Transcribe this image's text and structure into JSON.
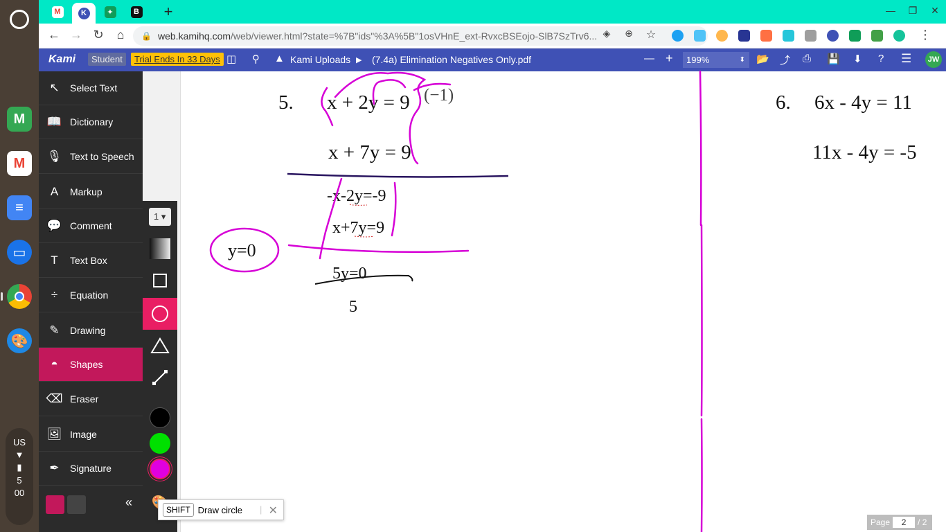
{
  "shelf": {
    "tray": {
      "locale": "US",
      "time_hour": "5",
      "time_min": "00"
    },
    "app_colors": {
      "meet": "#34a853",
      "gmail": "#ea4335",
      "docs": "#4285f4",
      "files": "#1a73e8",
      "chrome": "#fbbc04",
      "canvas": "#1e88e5"
    }
  },
  "browser": {
    "url_host": "web.kamihq.com",
    "url_path": "/web/viewer.html?state=%7B\"ids\"%3A%5B\"1osVHnE_ext-RvxcBSEojo-SlB7SzTrv6..."
  },
  "kami": {
    "logo": "Kami",
    "role_badge": "Student",
    "trial_badge": "Trial Ends In 33 Days",
    "breadcrumb_folder": "Kami Uploads",
    "breadcrumb_file": "(7.4a) Elimination Negatives Only.pdf",
    "zoom": "199%",
    "avatar": "JW"
  },
  "tools": [
    {
      "label": "Select Text",
      "icon": "↖"
    },
    {
      "label": "Dictionary",
      "icon": "📖"
    },
    {
      "label": "Text to Speech",
      "icon": "🎙"
    },
    {
      "label": "Markup",
      "icon": "A"
    },
    {
      "label": "Comment",
      "icon": "💬"
    },
    {
      "label": "Text Box",
      "icon": "T"
    },
    {
      "label": "Equation",
      "icon": "÷"
    },
    {
      "label": "Drawing",
      "icon": "✎"
    },
    {
      "label": "Shapes",
      "icon": "◓"
    },
    {
      "label": "Eraser",
      "icon": "⌫"
    },
    {
      "label": "Image",
      "icon": "🖼"
    },
    {
      "label": "Signature",
      "icon": "✒"
    }
  ],
  "shapes": {
    "stroke_width": "1",
    "colors": [
      "#000000",
      "#00e000",
      "#e000e0"
    ]
  },
  "document": {
    "p5_num": "5.",
    "p5_eq1": "x + 2y = 9",
    "p5_eq2": "x + 7y = 9",
    "p6_num": "6.",
    "p6_eq1": "6x - 4y = 11",
    "p6_eq2": "11x - 4y = -5",
    "hw_mult": "(−1)",
    "hw_line1": "-x-2y=-9",
    "hw_line2": "x+7y=9",
    "hw_result": "5y=0",
    "hw_divisor": "5",
    "hw_answer": "y=0"
  },
  "tooltip": {
    "key": "SHIFT",
    "text": "Draw circle"
  },
  "pager": {
    "label": "Page",
    "current": "2",
    "total": "/ 2"
  }
}
